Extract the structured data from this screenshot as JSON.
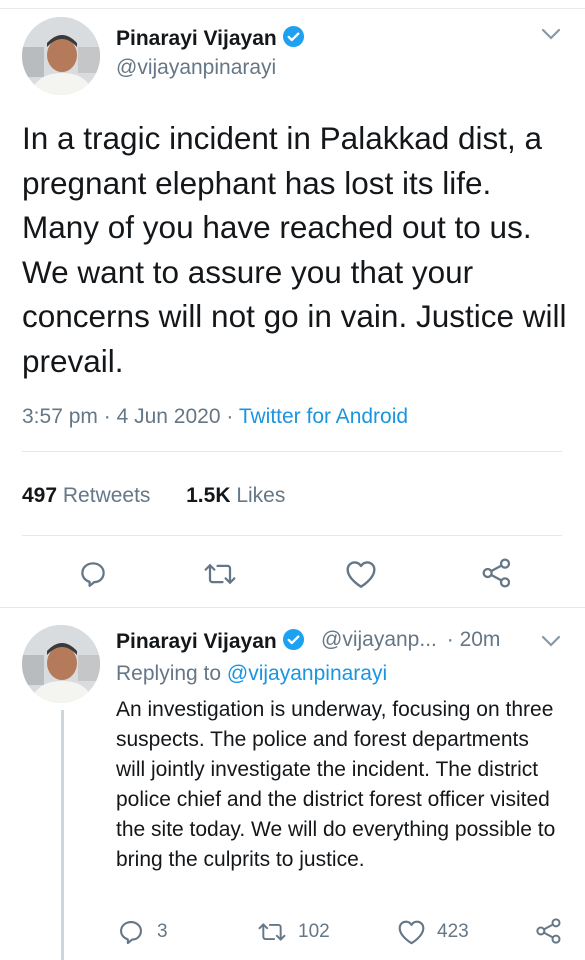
{
  "main_tweet": {
    "author_name": "Pinarayi Vijayan",
    "author_handle": "@vijayanpinarayi",
    "text": "In a tragic incident in Palakkad dist, a pregnant elephant has lost its life. Many of you have reached out to us. We want to assure you that your concerns will not go in vain. Justice will prevail.",
    "time": "3:57 pm",
    "date": "4 Jun 2020",
    "separator": "·",
    "source": "Twitter for Android",
    "retweets_count": "497",
    "retweets_label": "Retweets",
    "likes_count": "1.5K",
    "likes_label": "Likes",
    "actions": [
      "reply-icon",
      "retweet-icon",
      "like-icon",
      "share-icon"
    ]
  },
  "reply_tweet": {
    "author_name": "Pinarayi Vijayan",
    "author_handle": "@vijayanp...",
    "separator": "·",
    "time_ago": "20m",
    "replying_prefix": "Replying to",
    "replying_to": "@vijayanpinarayi",
    "text": "An investigation is underway, focusing on three suspects. The police and forest departments will jointly investigate the incident. The district police chief and the district forest officer visited the site today. We will do everything possible to bring the culprits to justice.",
    "reply_count": "3",
    "retweet_count": "102",
    "like_count": "423"
  },
  "colors": {
    "accent": "#1b95e0",
    "secondary_text": "#657786",
    "primary_text": "#14171a",
    "verified": "#1da1f2"
  }
}
